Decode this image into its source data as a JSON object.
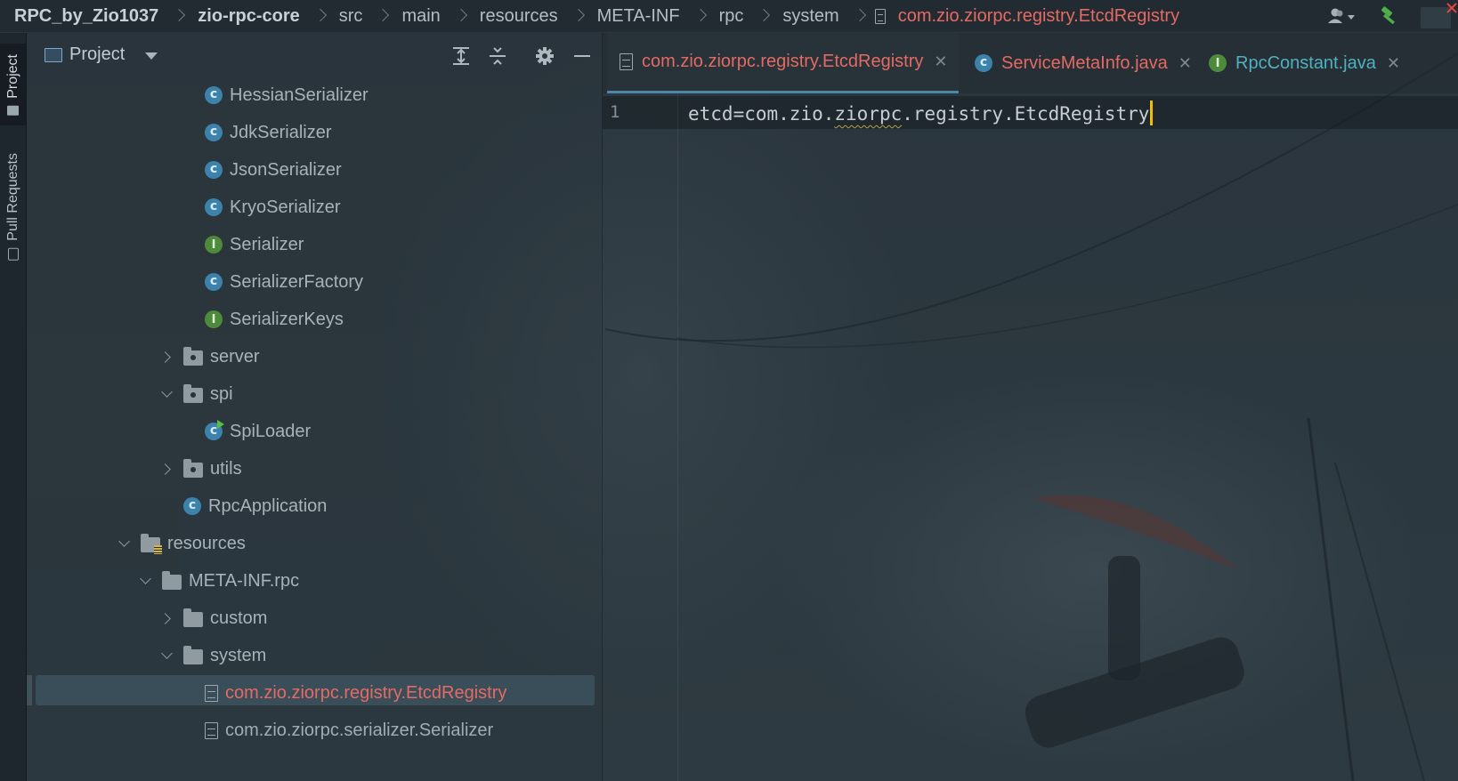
{
  "breadcrumb": {
    "project": "RPC_by_Zio1037",
    "items": [
      "zio-rpc-core",
      "src",
      "main",
      "resources",
      "META-INF",
      "rpc",
      "system"
    ],
    "file": "com.zio.ziorpc.registry.EtcdRegistry"
  },
  "tool_strip": {
    "project_tab": "Project",
    "pull_requests_tab": "Pull Requests"
  },
  "project_panel": {
    "title": "Project",
    "tree": [
      {
        "label": "HessianSerializer",
        "icon": "class-icon"
      },
      {
        "label": "JdkSerializer",
        "icon": "class-icon"
      },
      {
        "label": "JsonSerializer",
        "icon": "class-icon"
      },
      {
        "label": "KryoSerializer",
        "icon": "class-icon"
      },
      {
        "label": "Serializer",
        "icon": "interface-icon"
      },
      {
        "label": "SerializerFactory",
        "icon": "class-icon"
      },
      {
        "label": "SerializerKeys",
        "icon": "interface-icon"
      },
      {
        "label": "server",
        "icon": "package-folder-icon",
        "state": "collapsed"
      },
      {
        "label": "spi",
        "icon": "package-folder-icon",
        "state": "expanded"
      },
      {
        "label": "SpiLoader",
        "icon": "runnable-class-icon"
      },
      {
        "label": "utils",
        "icon": "package-folder-icon",
        "state": "collapsed"
      },
      {
        "label": "RpcApplication",
        "icon": "class-icon"
      },
      {
        "label": "resources",
        "icon": "resources-folder-icon",
        "state": "expanded"
      },
      {
        "label": "META-INF.rpc",
        "icon": "folder-icon",
        "state": "expanded"
      },
      {
        "label": "custom",
        "icon": "folder-icon",
        "state": "collapsed"
      },
      {
        "label": "system",
        "icon": "folder-icon",
        "state": "expanded"
      },
      {
        "label": "com.zio.ziorpc.registry.EtcdRegistry",
        "icon": "file-icon",
        "selected": true
      },
      {
        "label": "com.zio.ziorpc.serializer.Serializer",
        "icon": "file-icon"
      }
    ]
  },
  "editor": {
    "tabs": [
      {
        "label": "com.zio.ziorpc.registry.EtcdRegistry",
        "active": true
      },
      {
        "label": "ServiceMetaInfo.java"
      },
      {
        "label": "RpcConstant.java"
      }
    ],
    "lines": [
      {
        "number": "1",
        "text_before": "etcd=com.zio.",
        "text_squiggly": "ziorpc",
        "text_after": ".registry.EtcdRegistry"
      }
    ]
  },
  "colors": {
    "modified_file": "#e56a63",
    "teal_file": "#4fb0c0",
    "class_icon": "#3d82ab",
    "interface_icon": "#4e8a3c",
    "caret": "#f0c000"
  }
}
